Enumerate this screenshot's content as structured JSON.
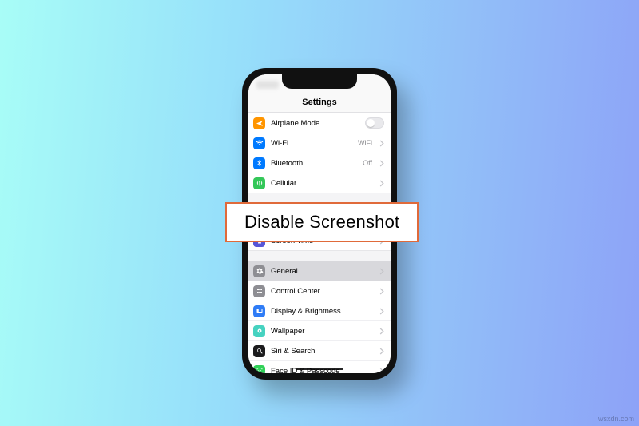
{
  "watermark": "wsxdn.com",
  "overlay": {
    "text": "Disable Screenshot"
  },
  "phone": {
    "nav_title": "Settings",
    "statusbar": {
      "signal_icon": "cellular-signal-icon",
      "wifi_icon": "wifi-icon",
      "battery_icon": "battery-icon"
    },
    "groups": [
      {
        "rows": [
          {
            "icon": "airplane-icon",
            "icon_color": "c-orange",
            "label": "Airplane Mode",
            "accessory": "toggle",
            "toggle_on": false
          },
          {
            "icon": "wifi-icon",
            "icon_color": "c-blue",
            "label": "Wi-Fi",
            "detail": "WiFi",
            "accessory": "chevron"
          },
          {
            "icon": "bluetooth-icon",
            "icon_color": "c-blue",
            "label": "Bluetooth",
            "detail": "Off",
            "accessory": "chevron"
          },
          {
            "icon": "antenna-icon",
            "icon_color": "c-green",
            "label": "Cellular",
            "accessory": "chevron"
          }
        ]
      },
      {
        "rows": [
          {
            "icon": "hourglass-icon",
            "icon_color": "c-purple",
            "label": "Screen Time",
            "accessory": "chevron"
          }
        ]
      },
      {
        "rows": [
          {
            "icon": "gear-icon",
            "icon_color": "c-gray",
            "label": "General",
            "accessory": "chevron",
            "highlight": true
          },
          {
            "icon": "sliders-icon",
            "icon_color": "c-gray",
            "label": "Control Center",
            "accessory": "chevron"
          },
          {
            "icon": "brightness-icon",
            "icon_color": "c-blue2",
            "label": "Display & Brightness",
            "accessory": "chevron"
          },
          {
            "icon": "wallpaper-icon",
            "icon_color": "c-teal",
            "label": "Wallpaper",
            "accessory": "chevron"
          },
          {
            "icon": "search-icon",
            "icon_color": "c-black",
            "label": "Siri & Search",
            "accessory": "chevron"
          },
          {
            "icon": "faceid-icon",
            "icon_color": "c-green2",
            "label": "Face ID & Passcode",
            "accessory": "chevron"
          }
        ]
      }
    ]
  }
}
